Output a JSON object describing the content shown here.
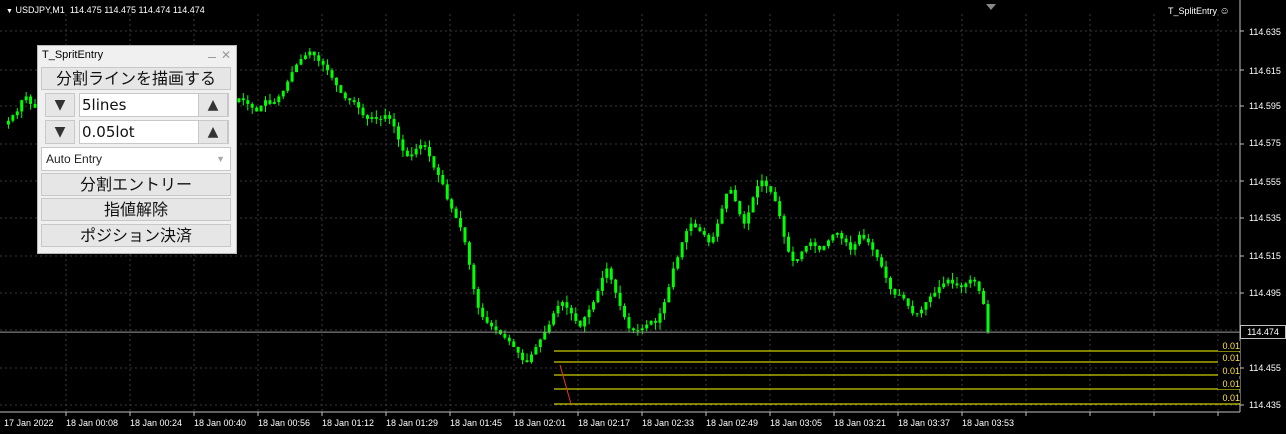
{
  "header": {
    "symbol": "USDJPY,M1",
    "prices": "114.475 114.475 114.474 114.474",
    "indicator_name": "T_SplitEntry"
  },
  "panel": {
    "title": "T_SpritEntry",
    "draw_lines_button": "分割ラインを描画する",
    "lines_value": "5lines",
    "lot_value": "0.05lot",
    "entry_mode": "Auto Entry",
    "split_entry_button": "分割エントリー",
    "cancel_limit_button": "指値解除",
    "close_positions_button": "ポジション決済",
    "down_arrow": "▼",
    "up_arrow": "▲"
  },
  "current_price": "114.474",
  "entry_lot_labels": [
    "0.01",
    "0.01",
    "0.01",
    "0.01",
    "0.01"
  ],
  "colors": {
    "background": "#000000",
    "candle": "#00ff00",
    "entry_line": "#ffff00",
    "grid": "#3a3a3a"
  },
  "chart_data": {
    "type": "candlestick",
    "y_ticks": [
      "114.635",
      "114.615",
      "114.595",
      "114.575",
      "114.555",
      "114.535",
      "114.515",
      "114.495",
      "114.455",
      "114.435"
    ],
    "x_ticks": [
      "17 Jan 2022",
      "18 Jan 00:08",
      "18 Jan 00:24",
      "18 Jan 00:40",
      "18 Jan 00:56",
      "18 Jan 01:12",
      "18 Jan 01:29",
      "18 Jan 01:45",
      "18 Jan 02:01",
      "18 Jan 02:17",
      "18 Jan 02:33",
      "18 Jan 02:49",
      "18 Jan 03:05",
      "18 Jan 03:21",
      "18 Jan 03:37",
      "18 Jan 03:53"
    ],
    "ylim": [
      114.43,
      114.645
    ],
    "entry_levels": [
      114.466,
      114.4595,
      114.453,
      114.4465,
      114.44
    ],
    "close_series": [
      114.585,
      114.587,
      114.59,
      114.592,
      114.598,
      114.6,
      114.596,
      114.594,
      114.596,
      114.6,
      114.601,
      114.599,
      114.596,
      114.593,
      114.59,
      114.587,
      114.585,
      114.588,
      114.59,
      114.594,
      114.596,
      114.6,
      114.603,
      114.602,
      114.6,
      114.598,
      114.596,
      114.593,
      114.589,
      114.585,
      114.582,
      114.58,
      114.579,
      114.579,
      114.581,
      114.586,
      114.592,
      114.597,
      114.601,
      114.604,
      114.603,
      114.602,
      114.6,
      114.598,
      114.6,
      114.604,
      114.602,
      114.599,
      114.596,
      114.594,
      114.592,
      114.594,
      114.597,
      114.599,
      114.598,
      114.596,
      114.594,
      114.592,
      114.595,
      114.598,
      114.596,
      114.597,
      114.6,
      114.603,
      114.608,
      114.613,
      114.617,
      114.62,
      114.622,
      114.624,
      114.622,
      114.619,
      114.617,
      114.614,
      114.61,
      114.606,
      114.602,
      114.599,
      114.598,
      114.597,
      114.594,
      114.59,
      114.588,
      114.589,
      114.588,
      114.588,
      114.59,
      114.588,
      114.584,
      114.577,
      114.571,
      114.568,
      114.569,
      114.572,
      114.574,
      114.573,
      114.568,
      114.562,
      114.558,
      114.553,
      114.545,
      114.54,
      114.535,
      114.53,
      114.522,
      114.51,
      114.497,
      114.487,
      114.482,
      114.479,
      114.477,
      114.475,
      114.473,
      114.471,
      114.469,
      114.466,
      114.463,
      114.459,
      114.458,
      114.462,
      114.466,
      114.47,
      114.474,
      114.478,
      114.484,
      114.488,
      114.49,
      114.487,
      114.484,
      114.48,
      114.477,
      114.482,
      114.486,
      114.49,
      114.496,
      114.503,
      114.508,
      114.502,
      114.495,
      114.488,
      114.482,
      114.476,
      114.475,
      114.475,
      114.476,
      114.478,
      114.48,
      114.479,
      114.484,
      114.49,
      114.498,
      114.508,
      114.514,
      114.522,
      114.528,
      114.532,
      114.53,
      114.528,
      114.526,
      114.522,
      114.525,
      114.532,
      114.54,
      114.548,
      114.55,
      114.544,
      114.537,
      114.532,
      114.538,
      114.546,
      114.552,
      114.555,
      114.552,
      114.549,
      114.544,
      114.536,
      114.525,
      114.517,
      114.512,
      114.513,
      114.517,
      114.52,
      114.522,
      114.52,
      114.518,
      114.52,
      114.523,
      114.526,
      114.527,
      114.524,
      114.522,
      114.518,
      114.521,
      114.526,
      114.524,
      114.522,
      114.518,
      114.514,
      114.509,
      114.503,
      114.497,
      114.494,
      114.494,
      114.492,
      114.488,
      114.484,
      114.484,
      114.486,
      114.49,
      114.493,
      114.495,
      114.498,
      114.5,
      114.502,
      114.5,
      114.499,
      114.498,
      114.5,
      114.502,
      114.501,
      114.496,
      114.489,
      114.474
    ]
  }
}
